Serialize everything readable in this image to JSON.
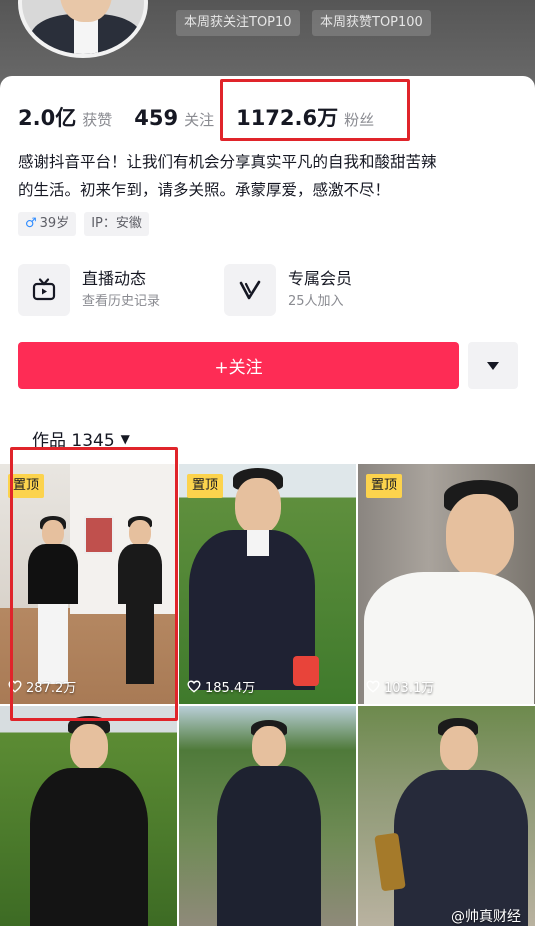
{
  "header": {
    "badges": [
      "本周获关注TOP10",
      "本周获赞TOP100"
    ]
  },
  "stats": [
    {
      "value": "2.0亿",
      "label": "获赞"
    },
    {
      "value": "459",
      "label": "关注"
    },
    {
      "value": "1172.6万",
      "label": "粉丝"
    }
  ],
  "bio": {
    "line1": "感谢抖音平台！让我们有机会分享真实平凡的自我和酸甜苦辣",
    "line2": "的生活。初来乍到，请多关照。承蒙厚爱，感激不尽！"
  },
  "tags": {
    "gender_symbol": "♂",
    "age": "39岁",
    "ip": "IP：安徽"
  },
  "features": [
    {
      "title": "直播动态",
      "subtitle": "查看历史记录",
      "icon": "tv-icon"
    },
    {
      "title": "专属会员",
      "subtitle": "25人加入",
      "icon": "v-member-icon"
    }
  ],
  "actions": {
    "follow_label": "+关注"
  },
  "works": {
    "tab_label": "作品 1345"
  },
  "videos": [
    {
      "pinned": "置顶",
      "likes": "287.2万"
    },
    {
      "pinned": "置顶",
      "likes": "185.4万"
    },
    {
      "pinned": "置顶",
      "likes": "103.1万"
    },
    {
      "pinned": "",
      "likes": ""
    },
    {
      "pinned": "",
      "likes": ""
    },
    {
      "pinned": "",
      "likes": ""
    }
  ],
  "watermark": "@帅真财经",
  "colors": {
    "accent": "#fe2c55",
    "highlight_box": "#e0242a",
    "pin_badge": "#fcd34d"
  }
}
